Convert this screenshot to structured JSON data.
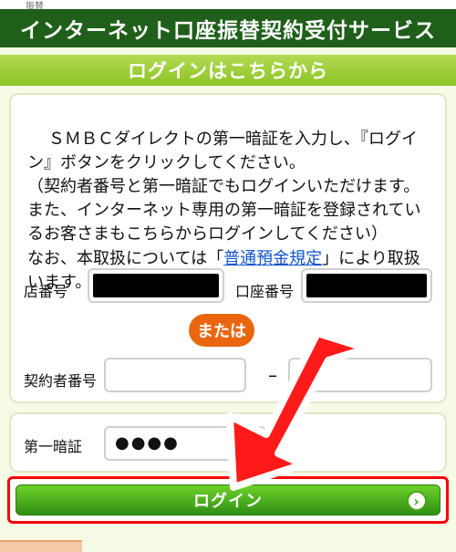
{
  "header": {
    "title": "インターネット口座振替契約受付サービス"
  },
  "top_strip": {
    "text": "振替"
  },
  "section": {
    "title": "ログインはこちらから"
  },
  "intro": {
    "text_before_link": "ＳＭＢＣダイレクトの第一暗証を入力し、『ログイン』ボタンをクリックしてください。\n（契約者番号と第一暗証でもログインいただけます。また、インターネット専用の第一暗証を登録されているお客さまもこちらからログインしてください）\nなお、本取扱については「",
    "link_text": "普通預金規定",
    "text_after_link": "」により取扱います。"
  },
  "labels": {
    "branch": "店番号",
    "account": "口座番号",
    "contract": "契約者番号",
    "pin": "第一暗証"
  },
  "buttons": {
    "or": "または",
    "login": "ログイン"
  },
  "fields": {
    "pin_value": "●●●●"
  },
  "icons": {
    "login_chevron": "chevron-right-icon",
    "pointer_arrow": "big-red-arrow-icon"
  },
  "colors": {
    "header_green": "#1f5f1a",
    "section_green": "#8cc424",
    "login_green": "#2f8f14",
    "highlight_red": "#ff0000",
    "or_orange": "#e9660f"
  }
}
